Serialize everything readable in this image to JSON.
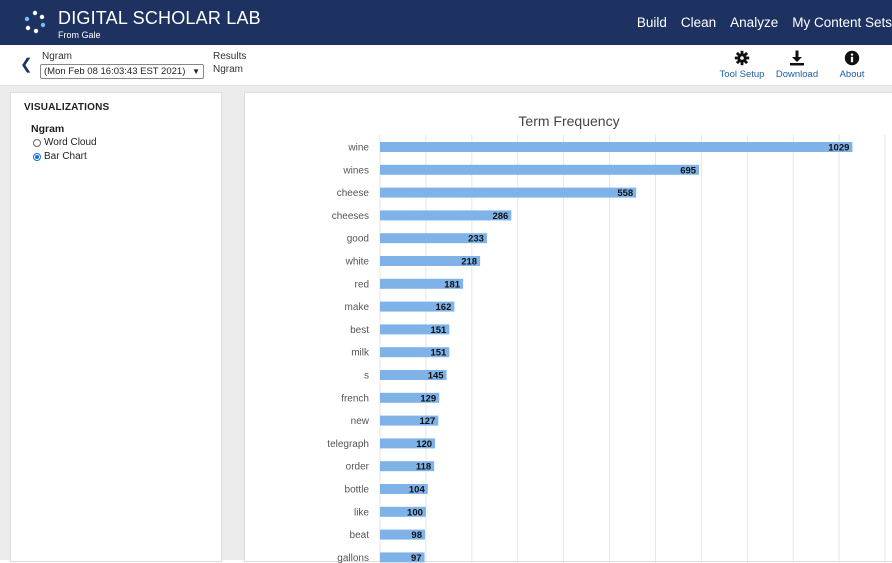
{
  "app": {
    "title": "DIGITAL SCHOLAR LAB",
    "subtitle": "From Gale",
    "nav": [
      "Build",
      "Clean",
      "Analyze",
      "My Content Sets"
    ]
  },
  "toolbar": {
    "back_icon": "chevron-left-icon",
    "ngram_label": "Ngram",
    "ngram_selected": "(Mon Feb 08 16:03:43 EST 2021)",
    "results_label": "Results",
    "results_value": "Ngram",
    "tools": [
      {
        "label": "Tool Setup",
        "icon": "gear-icon"
      },
      {
        "label": "Download",
        "icon": "download-icon"
      },
      {
        "label": "About",
        "icon": "info-icon"
      }
    ],
    "link_color": "#1d5fa8"
  },
  "sidebar": {
    "title": "VISUALIZATIONS",
    "group": "Ngram",
    "options": [
      {
        "label": "Word Cloud",
        "selected": false
      },
      {
        "label": "Bar Chart",
        "selected": true
      }
    ]
  },
  "colors": {
    "header_bg": "#1d3261",
    "bar": "#7fb3e8",
    "radio_accent": "#1a6fe0"
  },
  "chart_data": {
    "type": "bar",
    "orientation": "horizontal",
    "title": "Term Frequency",
    "categories": [
      "wine",
      "wines",
      "cheese",
      "cheeses",
      "good",
      "white",
      "red",
      "make",
      "best",
      "milk",
      "s",
      "french",
      "new",
      "telegraph",
      "order",
      "bottle",
      "like",
      "beat",
      "gallons"
    ],
    "values": [
      1029,
      695,
      558,
      286,
      233,
      218,
      181,
      162,
      151,
      151,
      145,
      129,
      127,
      120,
      118,
      104,
      100,
      98,
      97
    ],
    "xlim": [
      0,
      1100
    ],
    "grid": true,
    "data_labels": true
  }
}
